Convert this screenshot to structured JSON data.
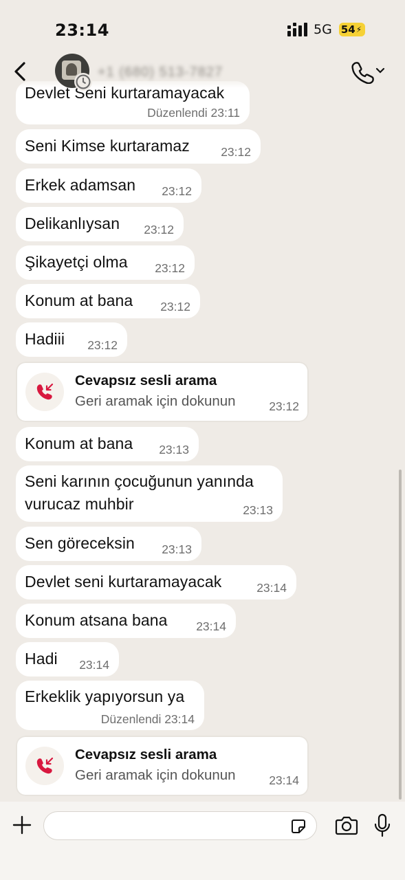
{
  "status_bar": {
    "time": "23:14",
    "network": "5G",
    "battery": "54"
  },
  "header": {
    "contact": "+1 (680) 513-7827"
  },
  "messages": [
    {
      "text": "Devlet Seni kurtaramayacak",
      "time": "Düzenlendi 23:11"
    },
    {
      "text": "Seni Kimse kurtaramaz",
      "time": "23:12"
    },
    {
      "text": "Erkek adamsan",
      "time": "23:12"
    },
    {
      "text": "Delikanlıysan",
      "time": "23:12"
    },
    {
      "text": "Şikayetçi olma",
      "time": "23:12"
    },
    {
      "text": "Konum at bana",
      "time": "23:12"
    },
    {
      "text": "Hadiii",
      "time": "23:12"
    },
    {
      "title": "Cevapsız sesli arama",
      "subtitle": "Geri aramak için dokunun",
      "time": "23:12"
    },
    {
      "text": "Konum at bana",
      "time": "23:13"
    },
    {
      "text_line1": "Seni karının çocuğunun yanında",
      "text_line2": "vurucaz muhbir",
      "time": "23:13"
    },
    {
      "text": "Sen göreceksin",
      "time": "23:13"
    },
    {
      "text": "Devlet seni kurtaramayacak",
      "time": "23:14"
    },
    {
      "text": "Konum atsana bana",
      "time": "23:14"
    },
    {
      "text": "Hadi",
      "time": "23:14"
    },
    {
      "text": "Erkeklik yapıyorsun ya",
      "time": "Düzenlendi 23:14"
    },
    {
      "title": "Cevapsız sesli arama",
      "subtitle": "Geri aramak için dokunun",
      "time": "23:14"
    }
  ],
  "colors": {
    "background": "#efebe6",
    "bubble": "#ffffff",
    "missed_call": "#d8183f",
    "battery": "#f6d136"
  },
  "icons": [
    "back-icon",
    "call-icon",
    "missed-call-icon",
    "plus-icon",
    "sticker-icon",
    "camera-icon",
    "mic-icon"
  ]
}
